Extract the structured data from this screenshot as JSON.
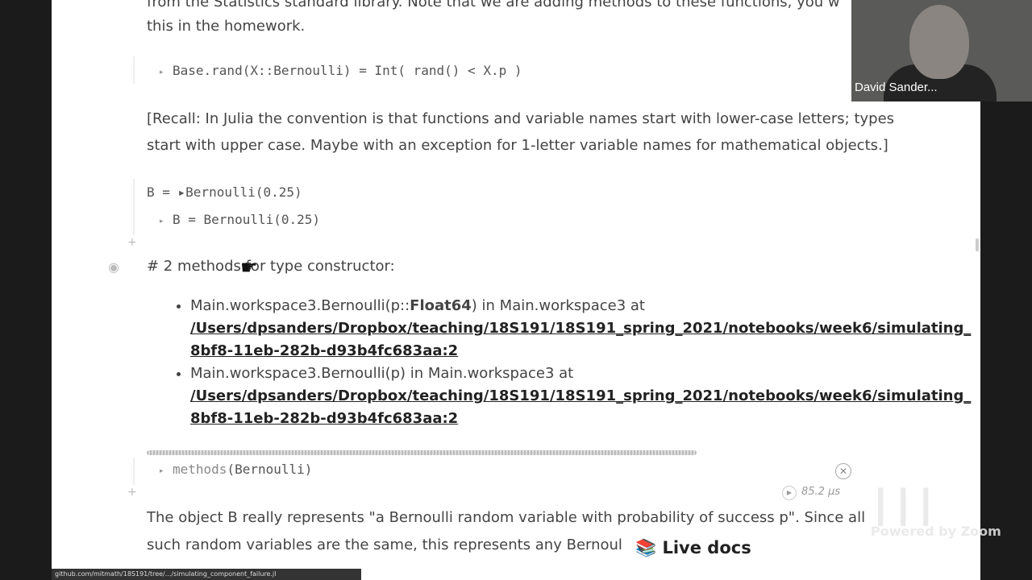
{
  "top_text": {
    "line1": "from the Statistics standard library. Note that we are adding methods to these functions, you w",
    "line2": "this in the homework."
  },
  "cell_rand": {
    "code": "Base.rand(X::Bernoulli) = Int( rand() < X.p )"
  },
  "recall_text": {
    "line1": "[Recall: In Julia the convention is that functions and variable names start with lower-case letters; types",
    "line2": "start with upper case. Maybe with an exception for 1-letter variable names for mathematical objects.]"
  },
  "cell_B": {
    "output": "B = ▸Bernoulli(0.25)",
    "code": "B = Bernoulli(0.25)"
  },
  "methods_output": {
    "heading": "# 2 methods for type constructor:",
    "items": [
      {
        "signature_prefix": "Main.workspace3.Bernoulli(p::",
        "signature_type": "Float64",
        "signature_suffix": ") in Main.workspace3 at",
        "link_line1": "/Users/dpsanders/Dropbox/teaching/18S191/18S191_spring_2021/notebooks/week6/simulating_",
        "link_line2": "8bf8-11eb-282b-d93b4fc683aa:2"
      },
      {
        "signature": "Main.workspace3.Bernoulli(p) in Main.workspace3 at",
        "link_line1": "/Users/dpsanders/Dropbox/teaching/18S191/18S191_spring_2021/notebooks/week6/simulating_",
        "link_line2": "8bf8-11eb-282b-d93b4fc683aa:2"
      }
    ]
  },
  "cell_methods": {
    "code_fn": "methods",
    "code_arg": "(Bernoulli)",
    "timing": "85.2 μs"
  },
  "bottom_text": {
    "line1": "The object B really represents \"a Bernoulli random variable with probability of success p\". Since all",
    "line2": "such random variables are the same, this represents any Bernoul"
  },
  "live_docs_label": "Live docs",
  "live_docs_icon": "books-icon",
  "webcam": {
    "name": "David Sander..."
  },
  "status_url": "github.com/mitmath/18S191/tree/.../simulating_component_failure.jl",
  "watermark": "Powered by Zoom",
  "colors": {
    "page_bg": "#ffffff",
    "frame_bg": "#1b1b1b",
    "text": "#444444"
  }
}
